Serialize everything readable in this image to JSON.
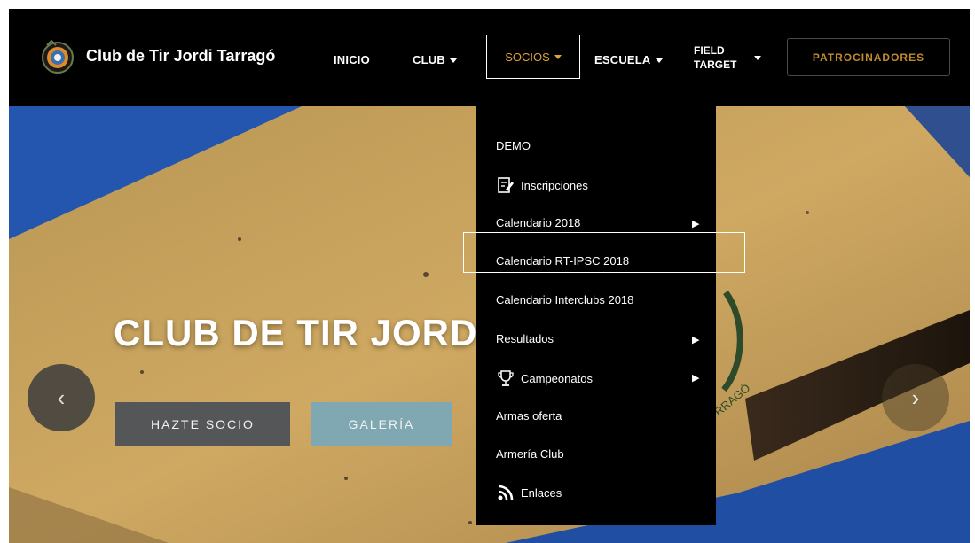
{
  "brand": {
    "name": "Club de Tir Jordi Tarragó"
  },
  "nav": {
    "inicio": "INICIO",
    "club": "CLUB",
    "socios": "SOCIOS",
    "escuela": "ESCUELA",
    "field_line1": "FIELD",
    "field_line2": "TARGET",
    "sponsors": "PATROCINADORES"
  },
  "dropdown": {
    "items": [
      {
        "label": "DEMO",
        "icon": "",
        "submenu": false
      },
      {
        "label": "Inscripciones",
        "icon": "edit-icon",
        "submenu": false
      },
      {
        "label": "Calendario 2018",
        "icon": "",
        "submenu": true
      },
      {
        "label": "Calendario RT-IPSC 2018",
        "icon": "",
        "submenu": false,
        "highlighted": true
      },
      {
        "label": "Calendario Interclubs 2018",
        "icon": "",
        "submenu": false
      },
      {
        "label": "Resultados",
        "icon": "",
        "submenu": true
      },
      {
        "label": "Campeonatos",
        "icon": "trophy-icon",
        "submenu": true
      },
      {
        "label": "Armas oferta",
        "icon": "",
        "submenu": false
      },
      {
        "label": "Armería Club",
        "icon": "",
        "submenu": false
      },
      {
        "label": "Enlaces",
        "icon": "rss-icon",
        "submenu": false
      }
    ]
  },
  "hero": {
    "title": "CLUB DE TIR JORDI",
    "cta_primary": "HAZTE SOCIO",
    "cta_secondary": "GALERÍA",
    "prev_arrow": "‹",
    "next_arrow": "›"
  },
  "colors": {
    "nav_bg": "#000000",
    "accent_orange": "#e0a43a",
    "sponsor_text": "#c08a2e",
    "sky_blue": "#1e4fa0",
    "wall": "#c9a45e",
    "btn_dark": "#555657",
    "btn_teal": "#7fa8b3"
  }
}
